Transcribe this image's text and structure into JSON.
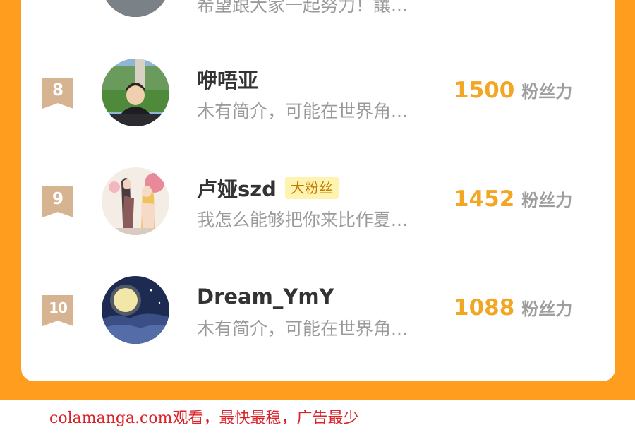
{
  "ranking": {
    "partial_row": {
      "bio": "希望跟大家一起努力！讓..."
    },
    "rows": [
      {
        "rank": "8",
        "name": "咿唔亚",
        "badge": "",
        "bio": "木有简介，可能在世界角...",
        "score": "1500",
        "score_unit": "粉丝力"
      },
      {
        "rank": "9",
        "name": "卢娅szd",
        "badge": "大粉丝",
        "bio": "我怎么能够把你来比作夏...",
        "score": "1452",
        "score_unit": "粉丝力"
      },
      {
        "rank": "10",
        "name": "Dream_YmY",
        "badge": "",
        "bio": "木有简介，可能在世界角...",
        "score": "1088",
        "score_unit": "粉丝力"
      }
    ]
  },
  "watermark": "colamanga.com观看，最快最稳，广告最少",
  "colors": {
    "frame": "#ff9d1f",
    "rank_badge": "#d6b492",
    "score": "#f2a623",
    "fan_badge_bg": "#fff3b0",
    "watermark": "#d9232a"
  }
}
